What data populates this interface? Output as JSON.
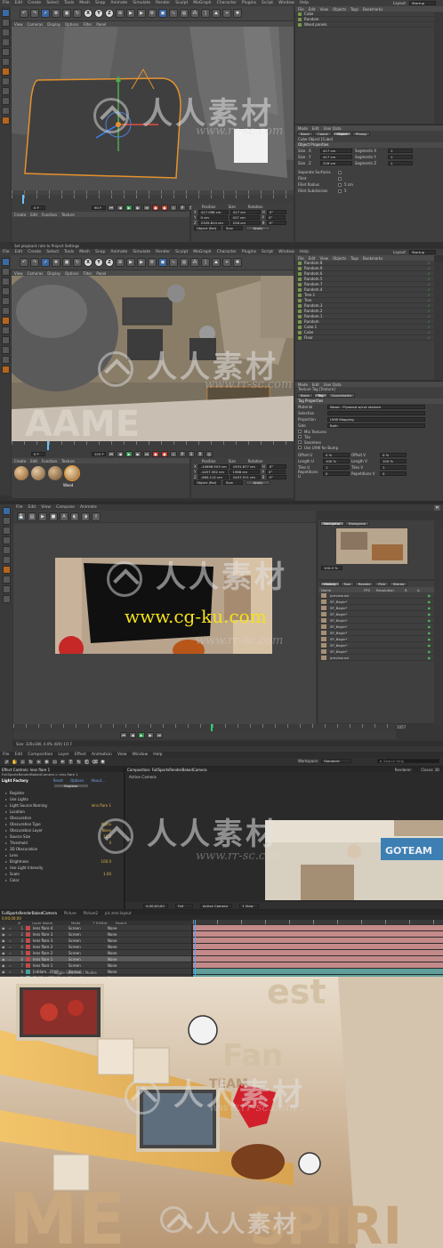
{
  "panel1": {
    "menu": [
      "File",
      "Edit",
      "Create",
      "Select",
      "Tools",
      "Mesh",
      "Snap",
      "Animate",
      "Simulate",
      "Render",
      "Sculpt",
      "MoGraph",
      "Character",
      "Plugins",
      "Script",
      "Window",
      "Help"
    ],
    "layout_label": "Layout:",
    "layout_value": "Startup",
    "viewport_menu": [
      "View",
      "Cameras",
      "Display",
      "Options",
      "Filter",
      "Panel"
    ],
    "viewport_label": "Perspective",
    "objects_menu": [
      "File",
      "Edit",
      "View",
      "Objects",
      "Tags",
      "Bookmarks"
    ],
    "objects": [
      "Cube",
      "Random",
      "Wood panels"
    ],
    "attr_menu": [
      "Mode",
      "Edit",
      "User Data"
    ],
    "attr_tabs": [
      "Basic",
      "Coord.",
      "Object",
      "Phong"
    ],
    "attr_title": "Cube Object [Cube]",
    "attr_section": "Object Properties",
    "size_fields": [
      {
        "label": "Size . X",
        "value": "417 cm",
        "seg_label": "Segments X",
        "seg": "1"
      },
      {
        "label": "Size . Y",
        "value": "417 cm",
        "seg_label": "Segments Y",
        "seg": "1"
      },
      {
        "label": "Size . Z",
        "value": "226 cm",
        "seg_label": "Segments Z",
        "seg": "1"
      }
    ],
    "extra_fields": [
      {
        "label": "Separate Surfaces",
        "value": ""
      },
      {
        "label": "Fillet",
        "value": ""
      },
      {
        "label": "Fillet Radius",
        "value": "5 cm"
      },
      {
        "label": "Fillet Subdivision",
        "value": "5"
      }
    ],
    "frame_current": "0 F",
    "frame_end": "90 F",
    "materials_menu": [
      "Create",
      "Edit",
      "Function",
      "Texture"
    ],
    "coord_headers": [
      "Position",
      "Size",
      "Rotation"
    ],
    "coords": [
      {
        "axis": "X",
        "pos": "417.096 cm",
        "size": "417 cm",
        "rot_label": "H",
        "rot": "0°"
      },
      {
        "axis": "Y",
        "pos": "0 cm",
        "size": "417 cm",
        "rot_label": "P",
        "rot": "0°"
      },
      {
        "axis": "Z",
        "pos": "2305.814 cm",
        "size": "226 cm",
        "rot_label": "B",
        "rot": "0°"
      }
    ],
    "coord_mode": "Object (Rel)",
    "coord_size_mode": "Size",
    "apply_label": "Apply",
    "status": "Set playback rate to Project Settings"
  },
  "panel2": {
    "viewport_label": "Perspective",
    "objects": [
      "Random.8",
      "Random.9",
      "Random.6",
      "Random.5",
      "Random.7",
      "Random.4",
      "Tree.1",
      "Tree",
      "Random.3",
      "Random.2",
      "Random.1",
      "Random",
      "Cube.1",
      "Cube",
      "Floor"
    ],
    "attr_title": "Texture Tag [Texture]",
    "attr_tabs": [
      "Basic",
      "Tag",
      "Coordinates"
    ],
    "attr_section": "Tag Properties",
    "tag_fields": [
      {
        "label": "Material",
        "value": "Wood - Plywood w/cut stained"
      },
      {
        "label": "Selection",
        "value": ""
      },
      {
        "label": "Projection",
        "value": "UVW Mapping"
      },
      {
        "label": "Side",
        "value": "Both"
      }
    ],
    "tag_checks": [
      "Mix Textures",
      "Tile",
      "Seamless",
      "Use UVW for Bump"
    ],
    "offsets": [
      {
        "l": "Offset U",
        "v": "0 %",
        "l2": "Offset V",
        "v2": "0 %"
      },
      {
        "l": "Length U",
        "v": "100 %",
        "l2": "Length V",
        "v2": "100 %"
      },
      {
        "l": "Tiles U",
        "v": "1",
        "l2": "Tiles V",
        "v2": "1"
      },
      {
        "l": "Repetitions U",
        "v": "0",
        "l2": "Repetitions V",
        "v2": "0"
      }
    ],
    "frame_current": "0 F",
    "frame_end": "120 F",
    "materials_menu": [
      "Create",
      "Edit",
      "Function",
      "Texture"
    ],
    "material_name": "Wood",
    "coords": [
      {
        "axis": "X",
        "pos": "-10696.503 cm",
        "size": "1931.677 cm",
        "rot_label": "H",
        "rot": "0°"
      },
      {
        "axis": "Y",
        "pos": "-1457.302 cm",
        "size": "1568 cm",
        "rot_label": "P",
        "rot": "0°"
      },
      {
        "axis": "Z",
        "pos": "-965.112 cm",
        "size": "2457.511 cm",
        "rot_label": "B",
        "rot": "0°"
      }
    ],
    "coord_mode": "Object (Rel)",
    "coord_size_mode": "Size",
    "apply_label": "Apply"
  },
  "panel3": {
    "menu": [
      "File",
      "Edit",
      "View",
      "Compose",
      "Animate"
    ],
    "right_tabs": [
      "Navigator",
      "Histogram"
    ],
    "zoom_readout": "100.0 %",
    "history_tabs": [
      "History",
      "Tool",
      "Render",
      "Pick",
      "Stereo"
    ],
    "history_header": [
      "Name",
      "FPS",
      "Resolution",
      "R",
      "A"
    ],
    "history_rows": [
      "preview.avi",
      "SP_Begin*",
      "SP_Begin*",
      "SP_Begin*",
      "SP_Begin*",
      "SP_Begin*",
      "SP_Begin*",
      "SP_Begin*",
      "SP_Begin*",
      "SP_Begin*",
      "preview.avi"
    ],
    "site_url": "www.cg-ku.com",
    "frame_end": "1057",
    "status": "Size: 320x180, 0.0% (0/0) 1/1 F"
  },
  "panel4": {
    "menu": [
      "File",
      "Edit",
      "Composition",
      "Layer",
      "Effect",
      "Animation",
      "View",
      "Window",
      "Help"
    ],
    "workspace_label": "Workspace:",
    "workspace_value": "Standard",
    "search_placeholder": "Search Help",
    "effect_tab": "Effect Controls: lens flare 1",
    "comp_tab": "Composition: FullSportsRenderBakedCamera",
    "breadcrumb": "FullSportsRenderBakedCamera > lens flare 1",
    "effect_name": "Light Factory",
    "effect_links": [
      "Reset",
      "Options",
      "About..."
    ],
    "register_label": "Register",
    "effect_props": [
      {
        "label": "Register",
        "value": ""
      },
      {
        "label": "Use Lights",
        "value": ""
      },
      {
        "label": "Light Source Naming",
        "value": "lens flare 1"
      },
      {
        "label": "Location",
        "value": ""
      },
      {
        "label": "Obscuration",
        "value": ""
      },
      {
        "label": "Obscuration Type",
        "value": "Alpha"
      },
      {
        "label": "Obscuration Layer",
        "value": "None"
      },
      {
        "label": "Source Size",
        "value": "10.0"
      },
      {
        "label": "Threshold",
        "value": "0"
      },
      {
        "label": "3D Obscuration",
        "value": ""
      },
      {
        "label": "Lens",
        "value": ""
      },
      {
        "label": "Brightness",
        "value": "100.0"
      },
      {
        "label": "Use Light Intensity",
        "value": ""
      },
      {
        "label": "Scale",
        "value": "1.00"
      },
      {
        "label": "Color",
        "value": ""
      }
    ],
    "active_camera": "Active Camera",
    "renderer_label": "Renderer:",
    "renderer_value": "Classic 3D",
    "view_controls": [
      "Full",
      "Active Camera",
      "1 View"
    ],
    "timecode": "0;00;00;00",
    "timeline_tabs": [
      "FullSportsRenderBakedCamera",
      "Picture",
      "Picture2",
      "pic zero layout"
    ],
    "layer_headers": [
      "#",
      "Layer Name",
      "Mode",
      "T TrkMat",
      "Parent"
    ],
    "layers": [
      {
        "n": "1",
        "name": "lens flare 4",
        "mode": "Screen",
        "parent": "None",
        "sw": "#c24b4b"
      },
      {
        "n": "2",
        "name": "lens flare 3",
        "mode": "Screen",
        "parent": "None",
        "sw": "#c24b4b"
      },
      {
        "n": "3",
        "name": "lens flare 3",
        "mode": "Screen",
        "parent": "None",
        "sw": "#c24b4b"
      },
      {
        "n": "4",
        "name": "lens flare 2",
        "mode": "Screen",
        "parent": "None",
        "sw": "#c24b4b"
      },
      {
        "n": "5",
        "name": "lens flare 2",
        "mode": "Screen",
        "parent": "None",
        "sw": "#c24b4b"
      },
      {
        "n": "6",
        "name": "lens flare 1",
        "mode": "Screen",
        "parent": "None",
        "sw": "#c24b4b"
      },
      {
        "n": "7",
        "name": "lens flare 1",
        "mode": "Screen",
        "parent": "None",
        "sw": "#c24b4b"
      },
      {
        "n": "8",
        "name": "[c4dam...0].tif",
        "mode": "Normal",
        "parent": "None",
        "sw": "#4aa0a0"
      },
      {
        "n": "9",
        "name": "[FullSp...05].tif",
        "mode": "Normal",
        "parent": "None",
        "sw": "#4aa0a0"
      },
      {
        "n": "10",
        "name": "[c4dam...0].tif",
        "mode": "Screen",
        "parent": "None",
        "sw": "#4aa0a0"
      }
    ],
    "toggle_label": "Toggle Switches / Modes"
  },
  "watermark_text": "人人素材",
  "watermark_url": "www.rr-sc.com",
  "colors": {
    "app_bg": "#2a2a2a",
    "panel_bg": "#3f3f3f",
    "accent_orange": "#e6922e",
    "ae_bar_pink": "#c48a8a",
    "ae_bar_teal": "#5f9e9a",
    "cg_url_yellow": "#f5e21b"
  }
}
